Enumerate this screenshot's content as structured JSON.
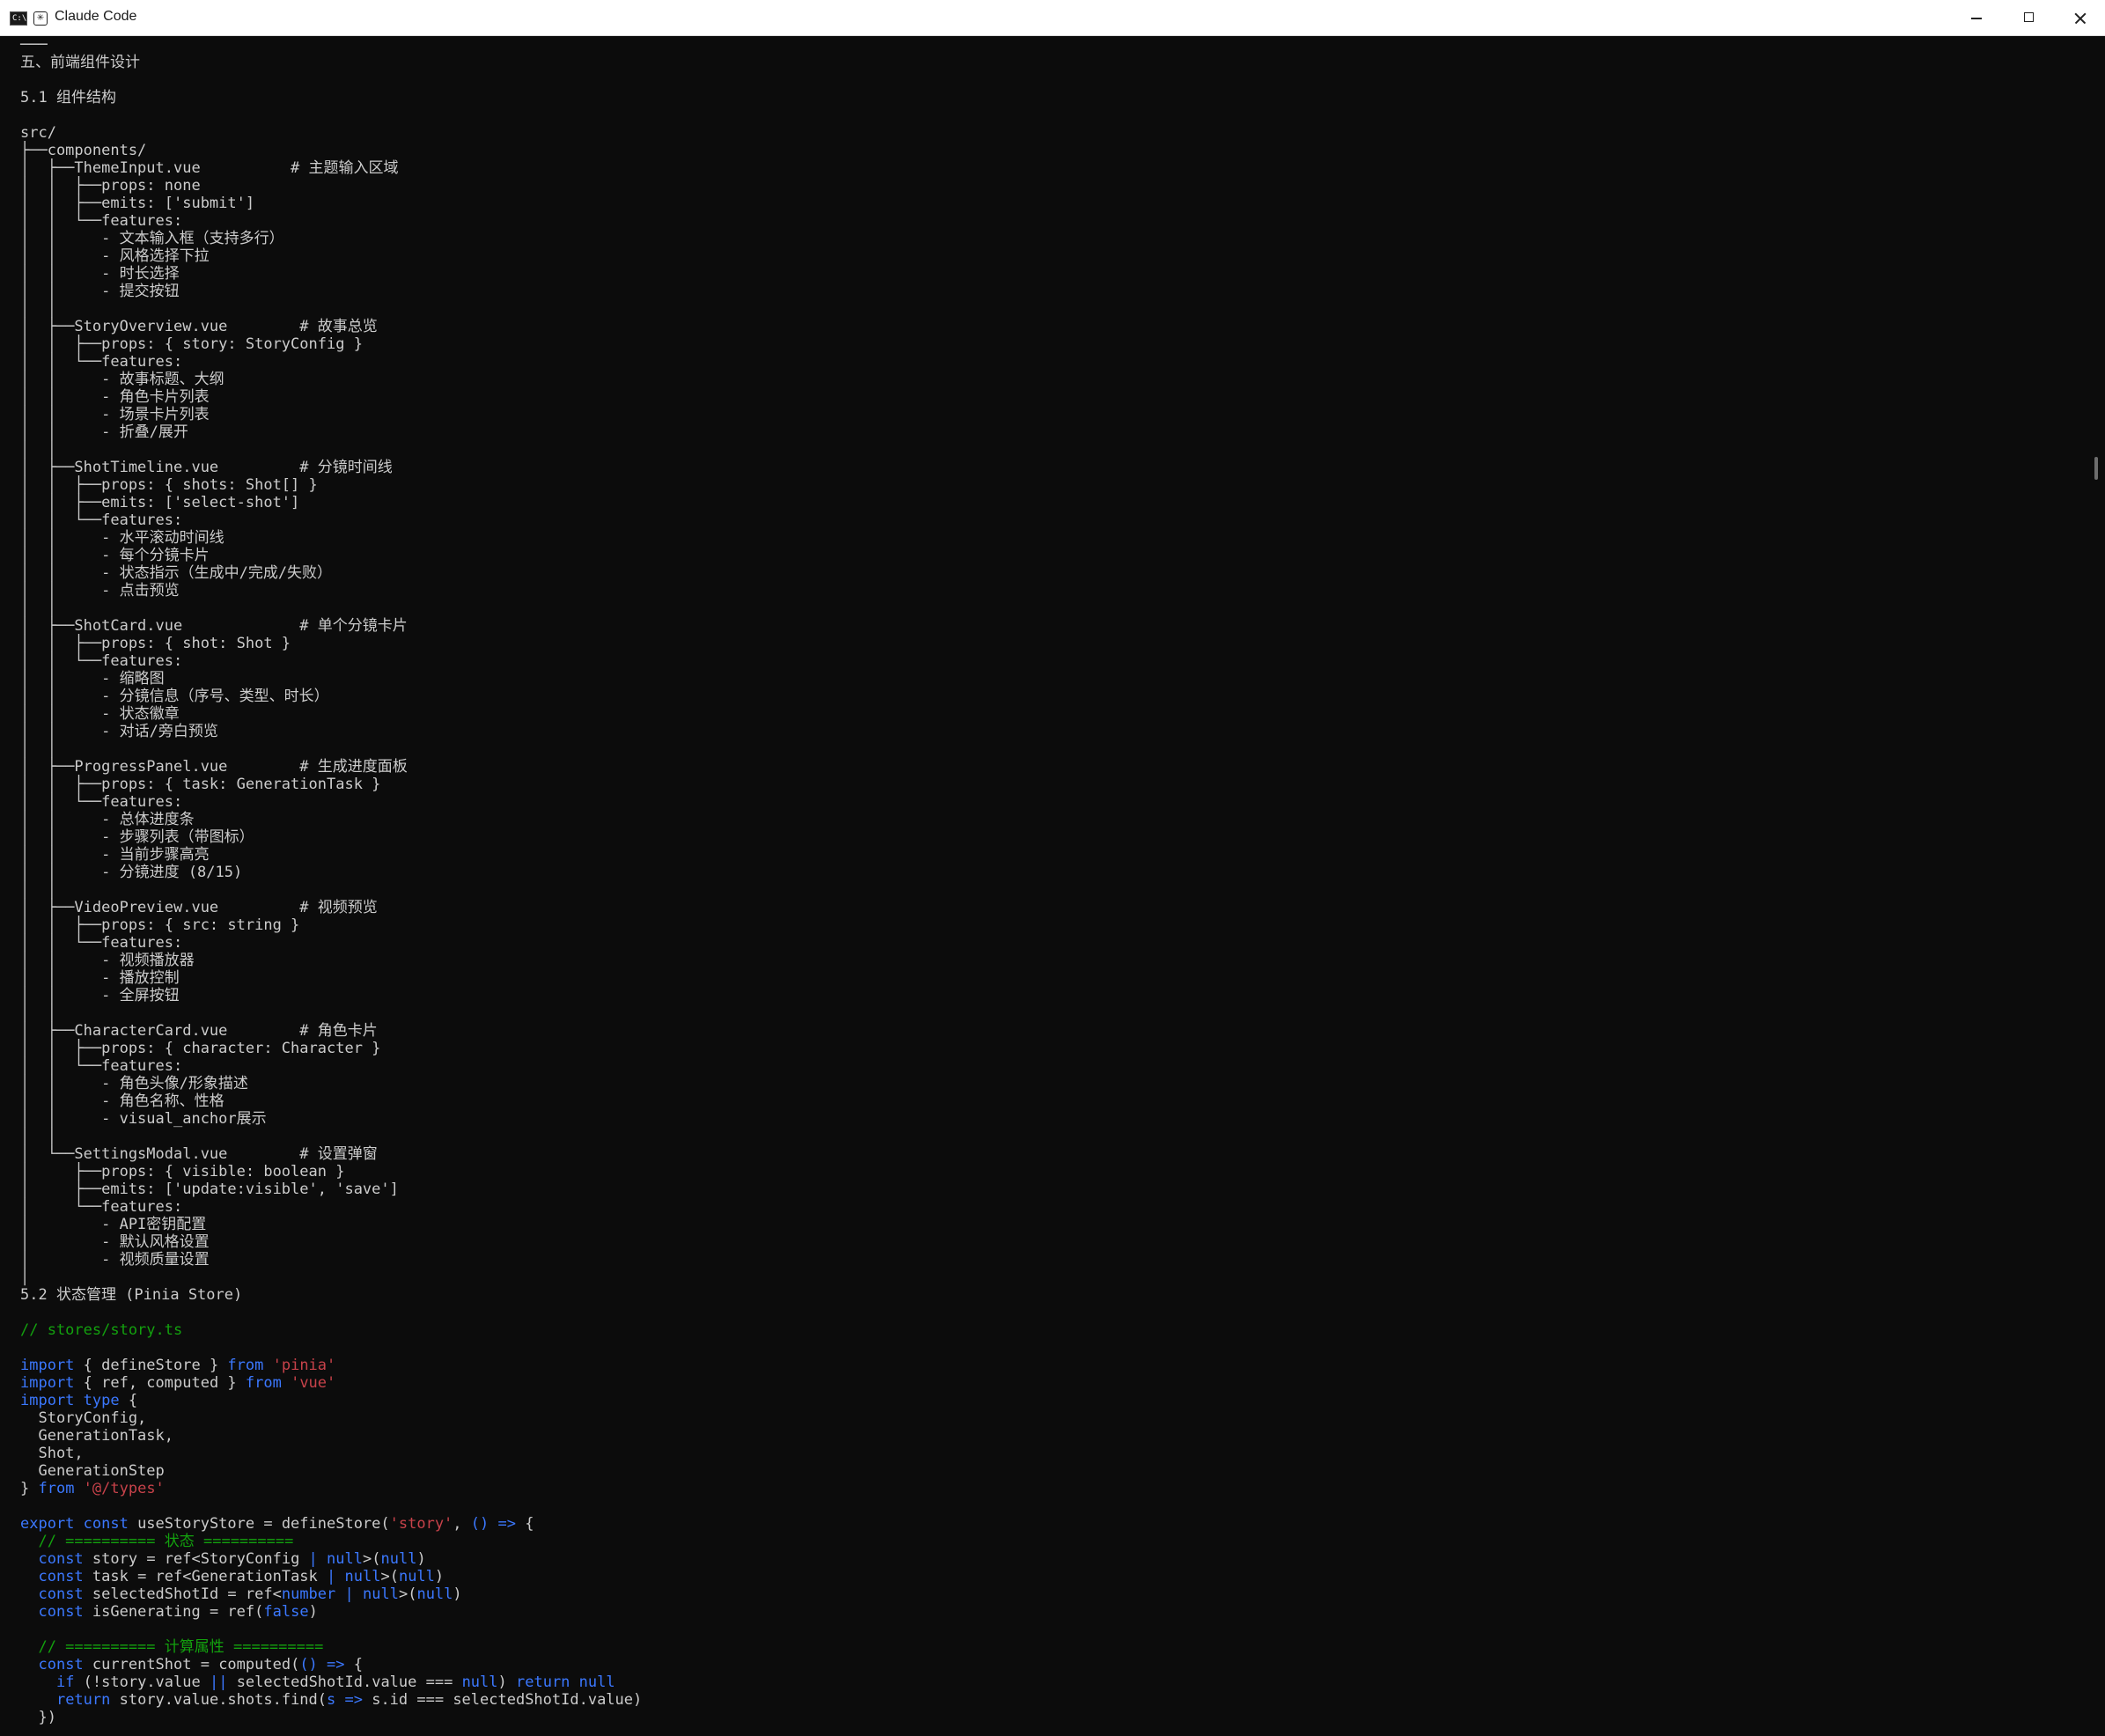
{
  "window": {
    "title": "Claude Code",
    "app_icon": "terminal-icon",
    "tab_icon": "claude-asterisk-icon",
    "controls": [
      "minimize-icon",
      "maximize-icon",
      "close-icon"
    ]
  },
  "colors": {
    "background": "#0c0c0c",
    "text": "#cccccc",
    "keyword": "#3b78ff",
    "string": "#c7424a",
    "comment": "#13a10e"
  },
  "terminal": {
    "lines": [
      [
        {
          "t": "───",
          "c": "text"
        }
      ],
      [
        {
          "t": "五、前端组件设计",
          "c": "text"
        }
      ],
      [
        {
          "t": "",
          "c": "text"
        }
      ],
      [
        {
          "t": "5.1 组件结构",
          "c": "text"
        }
      ],
      [
        {
          "t": "",
          "c": "text"
        }
      ],
      [
        {
          "t": "src/",
          "c": "text"
        }
      ],
      [
        {
          "t": "├──components/",
          "c": "text"
        }
      ],
      [
        {
          "t": "│  ├──ThemeInput.vue          # 主题输入区域",
          "c": "text"
        }
      ],
      [
        {
          "t": "│  │  ├──props: none",
          "c": "text"
        }
      ],
      [
        {
          "t": "│  │  ├──emits: ['submit']",
          "c": "text"
        }
      ],
      [
        {
          "t": "│  │  └──features:",
          "c": "text"
        }
      ],
      [
        {
          "t": "│  │     - 文本输入框（支持多行）",
          "c": "text"
        }
      ],
      [
        {
          "t": "│  │     - 风格选择下拉",
          "c": "text"
        }
      ],
      [
        {
          "t": "│  │     - 时长选择",
          "c": "text"
        }
      ],
      [
        {
          "t": "│  │     - 提交按钮",
          "c": "text"
        }
      ],
      [
        {
          "t": "│  │",
          "c": "text"
        }
      ],
      [
        {
          "t": "│  ├──StoryOverview.vue        # 故事总览",
          "c": "text"
        }
      ],
      [
        {
          "t": "│  │  ├──props: { story: StoryConfig }",
          "c": "text"
        }
      ],
      [
        {
          "t": "│  │  └──features:",
          "c": "text"
        }
      ],
      [
        {
          "t": "│  │     - 故事标题、大纲",
          "c": "text"
        }
      ],
      [
        {
          "t": "│  │     - 角色卡片列表",
          "c": "text"
        }
      ],
      [
        {
          "t": "│  │     - 场景卡片列表",
          "c": "text"
        }
      ],
      [
        {
          "t": "│  │     - 折叠/展开",
          "c": "text"
        }
      ],
      [
        {
          "t": "│  │",
          "c": "text"
        }
      ],
      [
        {
          "t": "│  ├──ShotTimeline.vue         # 分镜时间线",
          "c": "text"
        }
      ],
      [
        {
          "t": "│  │  ├──props: { shots: Shot[] }",
          "c": "text"
        }
      ],
      [
        {
          "t": "│  │  ├──emits: ['select-shot']",
          "c": "text"
        }
      ],
      [
        {
          "t": "│  │  └──features:",
          "c": "text"
        }
      ],
      [
        {
          "t": "│  │     - 水平滚动时间线",
          "c": "text"
        }
      ],
      [
        {
          "t": "│  │     - 每个分镜卡片",
          "c": "text"
        }
      ],
      [
        {
          "t": "│  │     - 状态指示（生成中/完成/失败）",
          "c": "text"
        }
      ],
      [
        {
          "t": "│  │     - 点击预览",
          "c": "text"
        }
      ],
      [
        {
          "t": "│  │",
          "c": "text"
        }
      ],
      [
        {
          "t": "│  ├──ShotCard.vue             # 单个分镜卡片",
          "c": "text"
        }
      ],
      [
        {
          "t": "│  │  ├──props: { shot: Shot }",
          "c": "text"
        }
      ],
      [
        {
          "t": "│  │  └──features:",
          "c": "text"
        }
      ],
      [
        {
          "t": "│  │     - 缩略图",
          "c": "text"
        }
      ],
      [
        {
          "t": "│  │     - 分镜信息（序号、类型、时长）",
          "c": "text"
        }
      ],
      [
        {
          "t": "│  │     - 状态徽章",
          "c": "text"
        }
      ],
      [
        {
          "t": "│  │     - 对话/旁白预览",
          "c": "text"
        }
      ],
      [
        {
          "t": "│  │",
          "c": "text"
        }
      ],
      [
        {
          "t": "│  ├──ProgressPanel.vue        # 生成进度面板",
          "c": "text"
        }
      ],
      [
        {
          "t": "│  │  ├──props: { task: GenerationTask }",
          "c": "text"
        }
      ],
      [
        {
          "t": "│  │  └──features:",
          "c": "text"
        }
      ],
      [
        {
          "t": "│  │     - 总体进度条",
          "c": "text"
        }
      ],
      [
        {
          "t": "│  │     - 步骤列表（带图标）",
          "c": "text"
        }
      ],
      [
        {
          "t": "│  │     - 当前步骤高亮",
          "c": "text"
        }
      ],
      [
        {
          "t": "│  │     - 分镜进度 (8/15)",
          "c": "text"
        }
      ],
      [
        {
          "t": "│  │",
          "c": "text"
        }
      ],
      [
        {
          "t": "│  ├──VideoPreview.vue         # 视频预览",
          "c": "text"
        }
      ],
      [
        {
          "t": "│  │  ├──props: { src: string }",
          "c": "text"
        }
      ],
      [
        {
          "t": "│  │  └──features:",
          "c": "text"
        }
      ],
      [
        {
          "t": "│  │     - 视频播放器",
          "c": "text"
        }
      ],
      [
        {
          "t": "│  │     - 播放控制",
          "c": "text"
        }
      ],
      [
        {
          "t": "│  │     - 全屏按钮",
          "c": "text"
        }
      ],
      [
        {
          "t": "│  │",
          "c": "text"
        }
      ],
      [
        {
          "t": "│  ├──CharacterCard.vue        # 角色卡片",
          "c": "text"
        }
      ],
      [
        {
          "t": "│  │  ├──props: { character: Character }",
          "c": "text"
        }
      ],
      [
        {
          "t": "│  │  └──features:",
          "c": "text"
        }
      ],
      [
        {
          "t": "│  │     - 角色头像/形象描述",
          "c": "text"
        }
      ],
      [
        {
          "t": "│  │     - 角色名称、性格",
          "c": "text"
        }
      ],
      [
        {
          "t": "│  │     - visual_anchor展示",
          "c": "text"
        }
      ],
      [
        {
          "t": "│  │",
          "c": "text"
        }
      ],
      [
        {
          "t": "│  └──SettingsModal.vue        # 设置弹窗",
          "c": "text"
        }
      ],
      [
        {
          "t": "│     ├──props: { visible: boolean }",
          "c": "text"
        }
      ],
      [
        {
          "t": "│     ├──emits: ['update:visible', 'save']",
          "c": "text"
        }
      ],
      [
        {
          "t": "│     └──features:",
          "c": "text"
        }
      ],
      [
        {
          "t": "│        - API密钥配置",
          "c": "text"
        }
      ],
      [
        {
          "t": "│        - 默认风格设置",
          "c": "text"
        }
      ],
      [
        {
          "t": "│        - 视频质量设置",
          "c": "text"
        }
      ],
      [
        {
          "t": "│",
          "c": "text"
        }
      ],
      [
        {
          "t": "5.2 状态管理 (Pinia Store)",
          "c": "text"
        }
      ],
      [
        {
          "t": "",
          "c": "text"
        }
      ],
      [
        {
          "t": "// stores/story.ts",
          "c": "comment"
        }
      ],
      [
        {
          "t": "",
          "c": "text"
        }
      ],
      [
        {
          "t": "import",
          "c": "kw"
        },
        {
          "t": " { defineStore } ",
          "c": "text"
        },
        {
          "t": "from",
          "c": "kw"
        },
        {
          "t": " 'pinia'",
          "c": "str"
        }
      ],
      [
        {
          "t": "import",
          "c": "kw"
        },
        {
          "t": " { ref, computed } ",
          "c": "text"
        },
        {
          "t": "from",
          "c": "kw"
        },
        {
          "t": " 'vue'",
          "c": "str"
        }
      ],
      [
        {
          "t": "import type",
          "c": "kw"
        },
        {
          "t": " {",
          "c": "text"
        }
      ],
      [
        {
          "t": "  StoryConfig,",
          "c": "text"
        }
      ],
      [
        {
          "t": "  GenerationTask,",
          "c": "text"
        }
      ],
      [
        {
          "t": "  Shot,",
          "c": "text"
        }
      ],
      [
        {
          "t": "  GenerationStep",
          "c": "text"
        }
      ],
      [
        {
          "t": "} ",
          "c": "text"
        },
        {
          "t": "from",
          "c": "kw"
        },
        {
          "t": " '@/types'",
          "c": "str"
        }
      ],
      [
        {
          "t": "",
          "c": "text"
        }
      ],
      [
        {
          "t": "export const",
          "c": "kw"
        },
        {
          "t": " useStoryStore = defineStore(",
          "c": "text"
        },
        {
          "t": "'story'",
          "c": "str"
        },
        {
          "t": ", ",
          "c": "text"
        },
        {
          "t": "() =>",
          "c": "kw"
        },
        {
          "t": " {",
          "c": "text"
        }
      ],
      [
        {
          "t": "  // ========== 状态 ==========",
          "c": "comment"
        }
      ],
      [
        {
          "t": "  ",
          "c": "text"
        },
        {
          "t": "const",
          "c": "kw"
        },
        {
          "t": " story = ref<StoryConfig ",
          "c": "text"
        },
        {
          "t": "|",
          "c": "kw"
        },
        {
          "t": " ",
          "c": "text"
        },
        {
          "t": "null",
          "c": "kw"
        },
        {
          "t": ">(",
          "c": "text"
        },
        {
          "t": "null",
          "c": "kw"
        },
        {
          "t": ")",
          "c": "text"
        }
      ],
      [
        {
          "t": "  ",
          "c": "text"
        },
        {
          "t": "const",
          "c": "kw"
        },
        {
          "t": " task = ref<GenerationTask ",
          "c": "text"
        },
        {
          "t": "|",
          "c": "kw"
        },
        {
          "t": " ",
          "c": "text"
        },
        {
          "t": "null",
          "c": "kw"
        },
        {
          "t": ">(",
          "c": "text"
        },
        {
          "t": "null",
          "c": "kw"
        },
        {
          "t": ")",
          "c": "text"
        }
      ],
      [
        {
          "t": "  ",
          "c": "text"
        },
        {
          "t": "const",
          "c": "kw"
        },
        {
          "t": " selectedShotId = ref<",
          "c": "text"
        },
        {
          "t": "number",
          "c": "kw"
        },
        {
          "t": " ",
          "c": "text"
        },
        {
          "t": "|",
          "c": "kw"
        },
        {
          "t": " ",
          "c": "text"
        },
        {
          "t": "null",
          "c": "kw"
        },
        {
          "t": ">(",
          "c": "text"
        },
        {
          "t": "null",
          "c": "kw"
        },
        {
          "t": ")",
          "c": "text"
        }
      ],
      [
        {
          "t": "  ",
          "c": "text"
        },
        {
          "t": "const",
          "c": "kw"
        },
        {
          "t": " isGenerating = ref(",
          "c": "text"
        },
        {
          "t": "false",
          "c": "kw"
        },
        {
          "t": ")",
          "c": "text"
        }
      ],
      [
        {
          "t": "",
          "c": "text"
        }
      ],
      [
        {
          "t": "  // ========== 计算属性 ==========",
          "c": "comment"
        }
      ],
      [
        {
          "t": "  ",
          "c": "text"
        },
        {
          "t": "const",
          "c": "kw"
        },
        {
          "t": " currentShot = computed(",
          "c": "text"
        },
        {
          "t": "() =>",
          "c": "kw"
        },
        {
          "t": " {",
          "c": "text"
        }
      ],
      [
        {
          "t": "    ",
          "c": "text"
        },
        {
          "t": "if",
          "c": "kw"
        },
        {
          "t": " (!story.value ",
          "c": "text"
        },
        {
          "t": "||",
          "c": "kw"
        },
        {
          "t": " selectedShotId.value === ",
          "c": "text"
        },
        {
          "t": "null",
          "c": "kw"
        },
        {
          "t": ") ",
          "c": "text"
        },
        {
          "t": "return null",
          "c": "kw"
        }
      ],
      [
        {
          "t": "    ",
          "c": "text"
        },
        {
          "t": "return",
          "c": "kw"
        },
        {
          "t": " story.value.shots.find(",
          "c": "text"
        },
        {
          "t": "s =>",
          "c": "kw"
        },
        {
          "t": " s.id === selectedShotId.value)",
          "c": "text"
        }
      ],
      [
        {
          "t": "  })",
          "c": "text"
        }
      ]
    ]
  }
}
